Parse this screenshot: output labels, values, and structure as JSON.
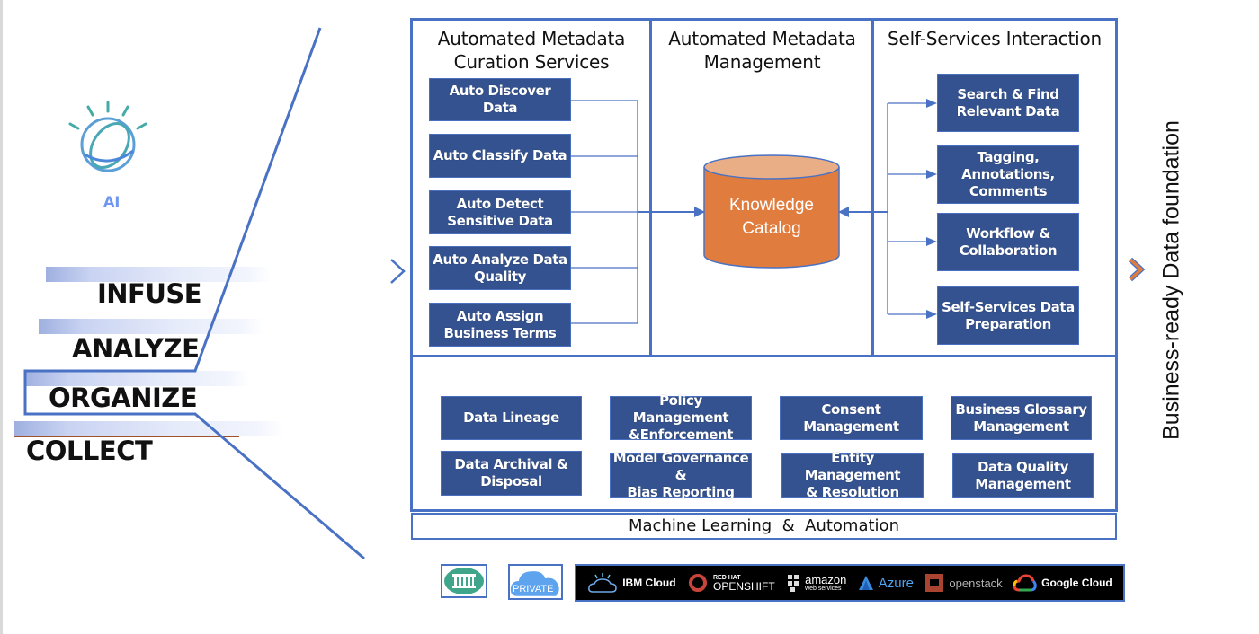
{
  "ai_badge": {
    "label": "AI",
    "icon": "watson-globe-icon"
  },
  "stages": [
    {
      "label": "INFUSE"
    },
    {
      "label": "ANALYZE"
    },
    {
      "label": "ORGANIZE",
      "highlighted": true
    },
    {
      "label": "COLLECT"
    }
  ],
  "panels": {
    "curation": {
      "title": "Automated Metadata\nCuration Services",
      "items": [
        "Auto Discover Data",
        "Auto Classify Data",
        "Auto Detect\nSensitive Data",
        "Auto Analyze Data\nQuality",
        "Auto Assign\nBusiness Terms"
      ]
    },
    "management": {
      "title": "Automated Metadata\nManagement",
      "catalog": "Knowledge\nCatalog"
    },
    "self_service": {
      "title": "Self-Services Interaction",
      "items": [
        "Search & Find\nRelevant Data",
        "Tagging,\nAnnotations,\nComments",
        "Workflow &\nCollaboration",
        "Self-Services Data\nPreparation"
      ]
    },
    "governance": {
      "items": [
        "Data Lineage",
        "Policy Management\n&Enforcement",
        "Consent\nManagement",
        "Business Glossary\nManagement",
        "Data Archival &\nDisposal",
        "Model Governance &\nBias Reporting",
        "Entity Management\n& Resolution",
        "Data Quality\nManagement"
      ]
    }
  },
  "ml_bar": {
    "label": "Machine Learning  &  Automation"
  },
  "output_label": "Business-ready Data foundation",
  "deployment": {
    "on_premise_icon": "bank-building-icon",
    "private_label": "PRIVATE",
    "clouds": [
      {
        "name": "IBM Cloud",
        "icon": "ibm-cloud-icon"
      },
      {
        "name": "OPENSHIFT",
        "sub": "RED HAT",
        "icon": "openshift-icon"
      },
      {
        "name": "amazon",
        "sub": "web services",
        "icon": "aws-icon"
      },
      {
        "name": "Azure",
        "icon": "azure-icon"
      },
      {
        "name": "openstack",
        "icon": "openstack-icon"
      },
      {
        "name": "Google Cloud",
        "icon": "google-cloud-icon"
      }
    ]
  },
  "colors": {
    "box_fill": "#34528f",
    "frame": "#4a72c4",
    "catalog_fill": "#e07d3e",
    "catalog_top": "#e9ae85",
    "output_chevron": "#e07d3e"
  }
}
